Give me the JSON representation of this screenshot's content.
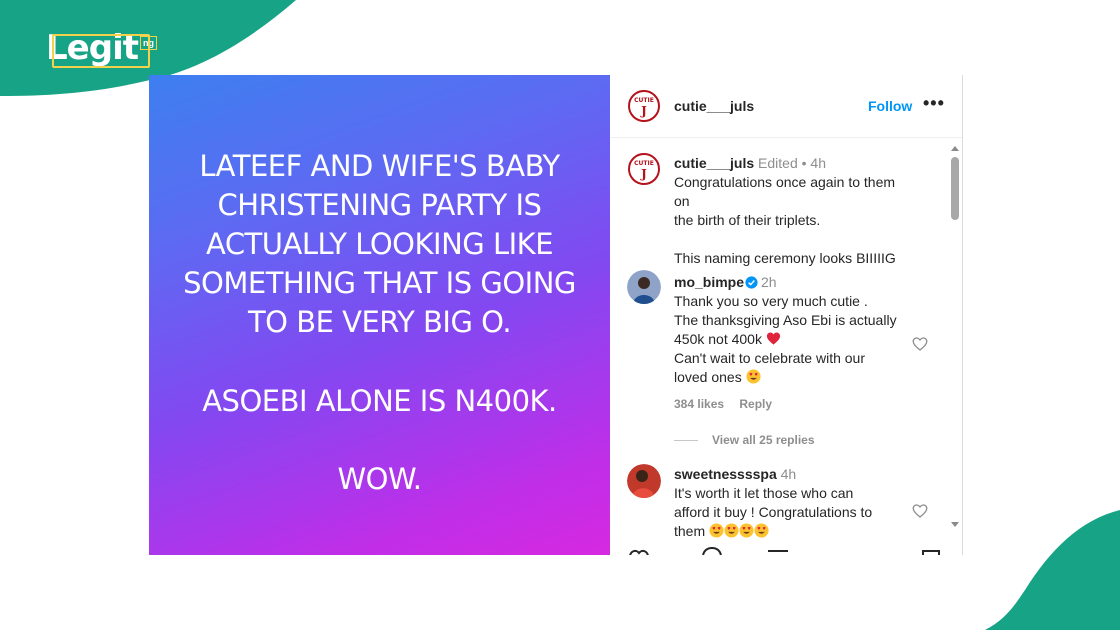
{
  "brand": {
    "logo_text": "Legit",
    "logo_suffix": "ng"
  },
  "post": {
    "lines": [
      "LATEEF AND WIFE'S BABY",
      "CHRISTENING PARTY IS",
      "ACTUALLY LOOKING LIKE",
      "SOMETHING THAT IS GOING",
      "TO BE VERY BIG O.",
      "ASOEBI ALONE IS N400K.",
      "WOW."
    ],
    "gradient_colors": [
      "#3d7ff0",
      "#8348f1",
      "#d629e0"
    ]
  },
  "header": {
    "username": "cutie___juls",
    "follow_label": "Follow",
    "more_label": "•••"
  },
  "comments": [
    {
      "username": "cutie___juls",
      "meta": "Edited • 4h",
      "text_lines": [
        "Congratulations once again to them on",
        "the birth of their triplets.",
        "",
        "This naming ceremony looks BIIIIIG"
      ]
    },
    {
      "username": "mo_bimpe",
      "verified": true,
      "time": "2h",
      "text_lines": [
        "Thank you so very much cutie .",
        "The thanksgiving Aso Ebi is actually",
        "450k not 400k",
        "Can't wait to celebrate with our",
        "loved ones"
      ],
      "likes": "384 likes",
      "reply_label": "Reply",
      "view_replies": "View all 25 replies"
    },
    {
      "username": "sweetnesssspa",
      "time": "4h",
      "text_lines": [
        "It's worth it let those who can",
        "afford it buy ! Congratulations to",
        "them"
      ]
    }
  ],
  "colors": {
    "brand_green": "#17a386",
    "link_blue": "#0095f6",
    "muted": "#8e8e8e"
  },
  "icons": [
    "heart-icon",
    "verified-badge-icon",
    "heart-eyes-emoji",
    "red-heart-emoji"
  ]
}
